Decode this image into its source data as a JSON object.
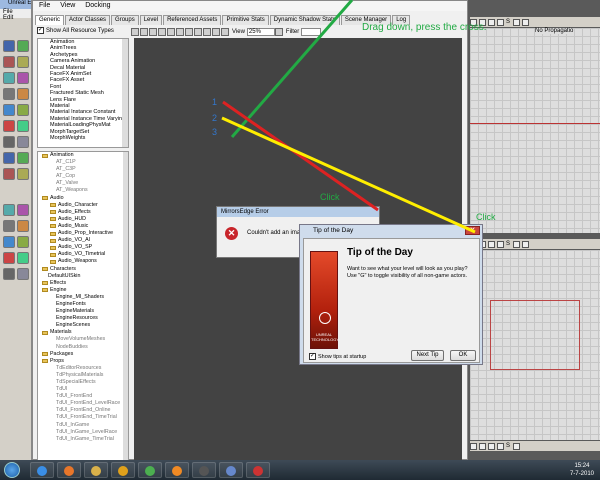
{
  "left_app": {
    "title": "Unreal E",
    "menu": [
      "File",
      "Edit"
    ]
  },
  "browser": {
    "menu": [
      "File",
      "View",
      "Docking"
    ],
    "tabs": [
      "Generic",
      "Actor Classes",
      "Groups",
      "Level",
      "Referenced Assets",
      "Primitive Stats",
      "Dynamic Shadow Stats",
      "Scene Manager",
      "Log"
    ],
    "show_all_label": "Show All Resource Types",
    "view_label": "View",
    "view_value": "25%",
    "filter_label": "Filter",
    "resource_types": [
      "Animation",
      "AnimTrees",
      "Archetypes",
      "Camera Animation",
      "Decal Material",
      "FaceFX AnimSet",
      "FaceFX Asset",
      "Font",
      "Fractured Static Mesh",
      "Lens Flare",
      "Material",
      "Material Instance Constant",
      "Material Instance Time Varying",
      "MaterialLoadingPhysMat",
      "MorphTargetSet",
      "MorphWeights"
    ],
    "packages": [
      {
        "label": "Animation",
        "depth": 0,
        "folder": true
      },
      {
        "label": "AT_C1P",
        "depth": 1,
        "folder": false,
        "dim": true
      },
      {
        "label": "AT_C3P",
        "depth": 1,
        "folder": false,
        "dim": true
      },
      {
        "label": "AT_Cop",
        "depth": 1,
        "folder": false,
        "dim": true
      },
      {
        "label": "AT_Valve",
        "depth": 1,
        "folder": false,
        "dim": true
      },
      {
        "label": "AT_Weapons",
        "depth": 1,
        "folder": false,
        "dim": true
      },
      {
        "label": "Audio",
        "depth": 0,
        "folder": true
      },
      {
        "label": "Audio_Character",
        "depth": 1,
        "folder": true
      },
      {
        "label": "Audio_Effects",
        "depth": 1,
        "folder": true
      },
      {
        "label": "Audio_HUD",
        "depth": 1,
        "folder": true
      },
      {
        "label": "Audio_Music",
        "depth": 1,
        "folder": true
      },
      {
        "label": "Audio_Prop_Interactive",
        "depth": 1,
        "folder": true
      },
      {
        "label": "Audio_VO_AI",
        "depth": 1,
        "folder": true
      },
      {
        "label": "Audio_VO_SP",
        "depth": 1,
        "folder": true
      },
      {
        "label": "Audio_VO_Timetrial",
        "depth": 1,
        "folder": true
      },
      {
        "label": "Audio_Weapons",
        "depth": 1,
        "folder": true
      },
      {
        "label": "Characters",
        "depth": 0,
        "folder": true
      },
      {
        "label": "DefaultUISkin",
        "depth": 0,
        "folder": false
      },
      {
        "label": "Effects",
        "depth": 0,
        "folder": true
      },
      {
        "label": "Engine",
        "depth": 0,
        "folder": true
      },
      {
        "label": "Engine_MI_Shaders",
        "depth": 1,
        "folder": false
      },
      {
        "label": "EngineFonts",
        "depth": 1,
        "folder": false
      },
      {
        "label": "EngineMaterials",
        "depth": 1,
        "folder": false
      },
      {
        "label": "EngineResources",
        "depth": 1,
        "folder": false
      },
      {
        "label": "EngineScenes",
        "depth": 1,
        "folder": false
      },
      {
        "label": "Materials",
        "depth": 0,
        "folder": true
      },
      {
        "label": "MoveVolumeMeshes",
        "depth": 1,
        "folder": false,
        "dim": true
      },
      {
        "label": "NodeBuddies",
        "depth": 1,
        "folder": false,
        "dim": true
      },
      {
        "label": "Packages",
        "depth": 0,
        "folder": true
      },
      {
        "label": "Props",
        "depth": 0,
        "folder": true
      },
      {
        "label": "TdEditorResources",
        "depth": 1,
        "folder": false,
        "dim": true
      },
      {
        "label": "TdPhysicalMaterials",
        "depth": 1,
        "folder": false,
        "dim": true
      },
      {
        "label": "TdSpecialEffects",
        "depth": 1,
        "folder": false,
        "dim": true
      },
      {
        "label": "TdUI",
        "depth": 1,
        "folder": false,
        "dim": true
      },
      {
        "label": "TdUI_FrontEnd",
        "depth": 1,
        "folder": false,
        "dim": true
      },
      {
        "label": "TdUI_FrontEnd_LevelRace",
        "depth": 1,
        "folder": false,
        "dim": true
      },
      {
        "label": "TdUI_FrontEnd_Online",
        "depth": 1,
        "folder": false,
        "dim": true
      },
      {
        "label": "TdUI_FrontEnd_TimeTrial",
        "depth": 1,
        "folder": false,
        "dim": true
      },
      {
        "label": "TdUI_InGame",
        "depth": 1,
        "folder": false,
        "dim": true
      },
      {
        "label": "TdUI_InGame_LevelRace",
        "depth": 1,
        "folder": false,
        "dim": true
      },
      {
        "label": "TdUI_InGame_TimeTrial",
        "depth": 1,
        "folder": false,
        "dim": true
      }
    ]
  },
  "viewport_toolbar": {
    "no_propagation": "No Propagatio",
    "lock_label": "S"
  },
  "error_dialog": {
    "title": "MirrorsEdge Error",
    "message": "Couldn't add an image to",
    "icon": "error-x"
  },
  "tip_dialog": {
    "title": "Tip of the Day",
    "heading": "Tip of the Day",
    "text": "Want to see what your level will look as you play? Use \"G\" to toggle visibility of all non-game actors.",
    "show_tips_label": "Show tips at startup",
    "next_tip_label": "Next Tip",
    "ok_label": "OK",
    "logo_text": "UNREAL TECHNOLOGY"
  },
  "annotations": {
    "drag_text": "Drag down, press the cross.",
    "click_1": "Click",
    "click_2": "Click",
    "num_1": "1",
    "num_2": "2",
    "num_3": "3"
  },
  "colors": {
    "green": "#22aa44",
    "red": "#dd2222",
    "yellow": "#ffee00",
    "blue": "#3377cc"
  },
  "taskbar": {
    "time": "15:24",
    "date": "7-7-2010",
    "icons": [
      "ie-icon",
      "firefox-icon",
      "explorer-icon",
      "media-player-icon",
      "chrome-icon",
      "vlc-icon",
      "unreal-icon",
      "document-icon",
      "paint-icon"
    ]
  }
}
